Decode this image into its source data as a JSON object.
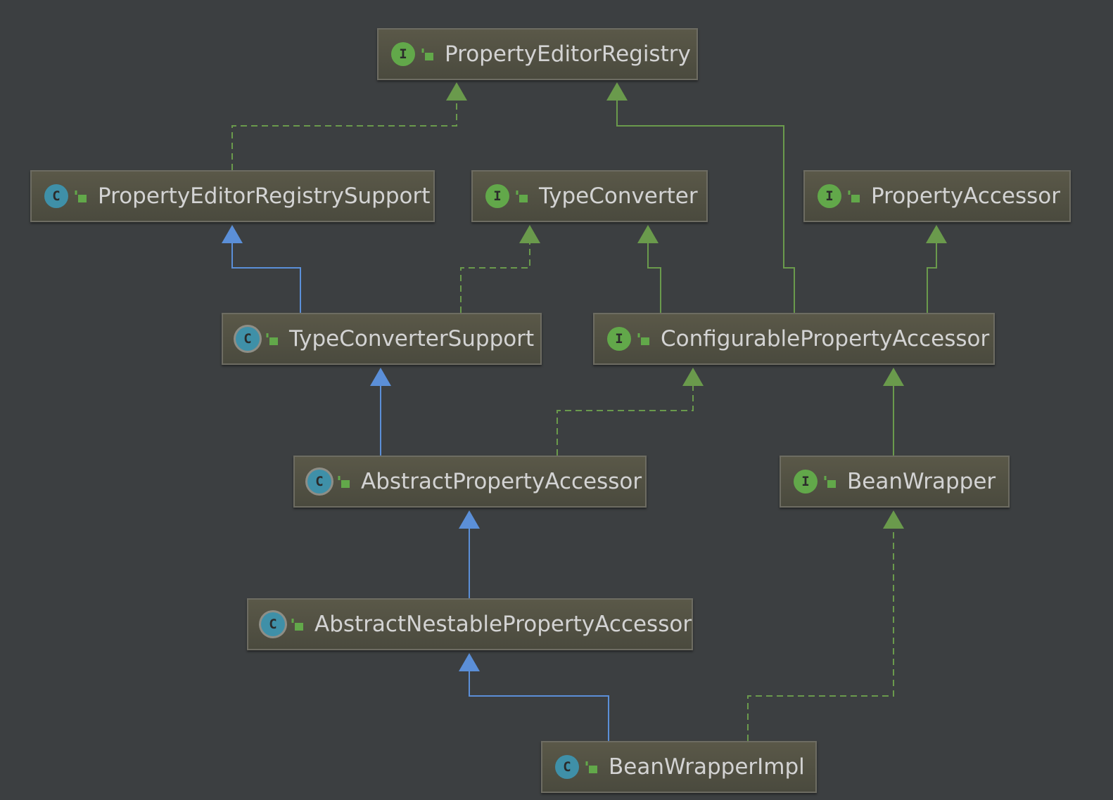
{
  "colors": {
    "background": "#3c3f41",
    "interface_icon": "#62a84a",
    "class_icon": "#3f90a8",
    "implements_edge": "#6a9a4c",
    "extends_edge": "#5b8fd8",
    "label_text": "#d3d3d3"
  },
  "icons": {
    "interface": "I",
    "class": "C",
    "visibility": "public-lock-icon"
  },
  "nodes": [
    {
      "id": "property-editor-registry",
      "label": "PropertyEditorRegistry",
      "kind": "interface"
    },
    {
      "id": "property-editor-registry-support",
      "label": "PropertyEditorRegistrySupport",
      "kind": "class"
    },
    {
      "id": "type-converter",
      "label": "TypeConverter",
      "kind": "interface"
    },
    {
      "id": "property-accessor",
      "label": "PropertyAccessor",
      "kind": "interface"
    },
    {
      "id": "type-converter-support",
      "label": "TypeConverterSupport",
      "kind": "abstract-class"
    },
    {
      "id": "configurable-property-accessor",
      "label": "ConfigurablePropertyAccessor",
      "kind": "interface"
    },
    {
      "id": "abstract-property-accessor",
      "label": "AbstractPropertyAccessor",
      "kind": "abstract-class"
    },
    {
      "id": "bean-wrapper",
      "label": "BeanWrapper",
      "kind": "interface"
    },
    {
      "id": "abstract-nestable-property-accessor",
      "label": "AbstractNestablePropertyAccessor",
      "kind": "abstract-class"
    },
    {
      "id": "bean-wrapper-impl",
      "label": "BeanWrapperImpl",
      "kind": "class"
    }
  ],
  "edges": [
    {
      "from": "property-editor-registry-support",
      "to": "property-editor-registry",
      "type": "implements"
    },
    {
      "from": "configurable-property-accessor",
      "to": "property-editor-registry",
      "type": "interface-extends"
    },
    {
      "from": "type-converter-support",
      "to": "property-editor-registry-support",
      "type": "extends"
    },
    {
      "from": "type-converter-support",
      "to": "type-converter",
      "type": "implements"
    },
    {
      "from": "configurable-property-accessor",
      "to": "type-converter",
      "type": "interface-extends"
    },
    {
      "from": "configurable-property-accessor",
      "to": "property-accessor",
      "type": "interface-extends"
    },
    {
      "from": "abstract-property-accessor",
      "to": "type-converter-support",
      "type": "extends"
    },
    {
      "from": "abstract-property-accessor",
      "to": "configurable-property-accessor",
      "type": "implements"
    },
    {
      "from": "bean-wrapper",
      "to": "configurable-property-accessor",
      "type": "interface-extends"
    },
    {
      "from": "abstract-nestable-property-accessor",
      "to": "abstract-property-accessor",
      "type": "extends"
    },
    {
      "from": "bean-wrapper-impl",
      "to": "abstract-nestable-property-accessor",
      "type": "extends"
    },
    {
      "from": "bean-wrapper-impl",
      "to": "bean-wrapper",
      "type": "implements"
    }
  ]
}
